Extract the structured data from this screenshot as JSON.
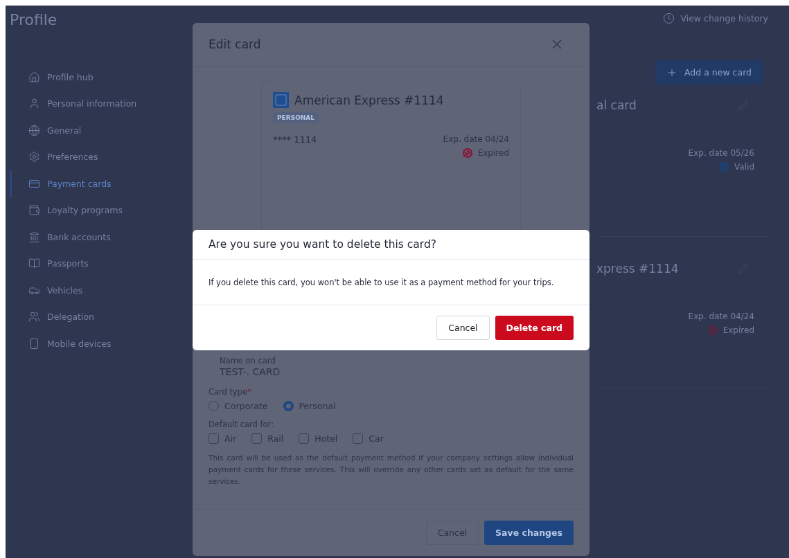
{
  "page": {
    "title": "Profile",
    "history_link": "View change history",
    "add_button": "Add a new card"
  },
  "sidebar": {
    "items": [
      {
        "label": "Profile hub",
        "selected": false
      },
      {
        "label": "Personal information",
        "selected": false
      },
      {
        "label": "General",
        "selected": false
      },
      {
        "label": "Preferences",
        "selected": false
      },
      {
        "label": "Payment cards",
        "selected": true
      },
      {
        "label": "Loyalty programs",
        "selected": false
      },
      {
        "label": "Bank accounts",
        "selected": false
      },
      {
        "label": "Passports",
        "selected": false
      },
      {
        "label": "Vehicles",
        "selected": false
      },
      {
        "label": "Delegation",
        "selected": false
      },
      {
        "label": "Mobile devices",
        "selected": false
      }
    ]
  },
  "cards": [
    {
      "title": "al card",
      "expiry": "Exp. date 05/26",
      "status": "Valid",
      "kind": "valid"
    },
    {
      "title": "xpress #1114",
      "expiry": "Exp. date 04/24",
      "status": "Expired",
      "kind": "expired"
    }
  ],
  "edit_modal": {
    "title": "Edit card",
    "preview": {
      "name": "American Express #1114",
      "tag": "PERSONAL",
      "number": "**** 1114",
      "expiry": "Exp. date 04/24",
      "status": "Expired",
      "kind": "expired"
    },
    "name_on_card": {
      "label": "Name on card",
      "value": "TEST-. CARD"
    },
    "card_type": {
      "label": "Card type",
      "required": "*",
      "options": [
        {
          "label": "Corporate",
          "selected": false
        },
        {
          "label": "Personal",
          "selected": true
        }
      ]
    },
    "default_for": {
      "label": "Default card for:",
      "options": [
        {
          "label": "Air",
          "checked": false
        },
        {
          "label": "Rail",
          "checked": false
        },
        {
          "label": "Hotel",
          "checked": false
        },
        {
          "label": "Car",
          "checked": false
        }
      ]
    },
    "help": "This card will be used as the default payment method if your company settings allow individual payment cards for these services. This will override any other cards set as default for the same services.",
    "cancel": "Cancel",
    "save": "Save changes"
  },
  "confirm_dialog": {
    "title": "Are you sure you want to delete this card?",
    "message": "If you delete this card, you won't be able to use it as a payment method for your trips.",
    "cancel": "Cancel",
    "delete": "Delete card"
  }
}
